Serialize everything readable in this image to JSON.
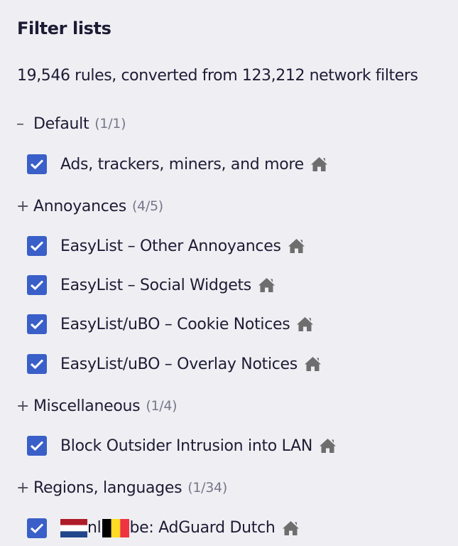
{
  "header": {
    "title": "Filter lists"
  },
  "summary": "19,546 rules, converted from 123,212 network filters",
  "colors": {
    "checkbox": "#3a5fc8",
    "icon": "#6e6e6e",
    "text": "#1e1b35",
    "count": "#77768a"
  },
  "groups": [
    {
      "toggle": "–",
      "label": "Default",
      "count": "(1/1)",
      "items": [
        {
          "label": "Ads, trackers, miners, and more",
          "checked": true,
          "icon": "home-icon"
        }
      ]
    },
    {
      "toggle": "+",
      "label": "Annoyances",
      "count": "(4/5)",
      "items": [
        {
          "label": "EasyList – Other Annoyances",
          "checked": true,
          "icon": "home-icon"
        },
        {
          "label": "EasyList – Social Widgets",
          "checked": true,
          "icon": "home-icon"
        },
        {
          "label": "EasyList/uBO – Cookie Notices",
          "checked": true,
          "icon": "home-icon"
        },
        {
          "label": "EasyList/uBO – Overlay Notices",
          "checked": true,
          "icon": "home-icon"
        }
      ]
    },
    {
      "toggle": "+",
      "label": "Miscellaneous",
      "count": "(1/4)",
      "items": [
        {
          "label": "Block Outsider Intrusion into LAN",
          "checked": true,
          "icon": "home-icon"
        }
      ]
    },
    {
      "toggle": "+",
      "label": "Regions, languages",
      "count": "(1/34)",
      "items": [
        {
          "prefix1": "nl",
          "label": "be: AdGuard Dutch",
          "checked": true,
          "icon": "home-icon",
          "flags": [
            "netherlands-flag",
            "belgium-flag"
          ]
        }
      ]
    }
  ]
}
